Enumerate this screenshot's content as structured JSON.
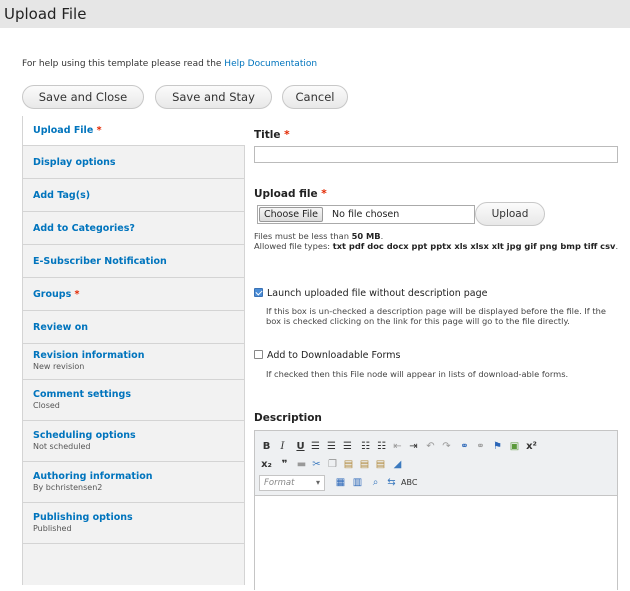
{
  "header": {
    "title": "Upload File"
  },
  "help": {
    "prefix": "For help using this template please read the ",
    "link": "Help Documentation"
  },
  "actions": {
    "save_close": "Save and Close",
    "save_stay": "Save and Stay",
    "cancel": "Cancel"
  },
  "tabs": [
    {
      "title": "Upload File",
      "required": true,
      "summary": ""
    },
    {
      "title": "Display options",
      "required": false,
      "summary": ""
    },
    {
      "title": "Add Tag(s)",
      "required": false,
      "summary": ""
    },
    {
      "title": "Add to Categories?",
      "required": false,
      "summary": ""
    },
    {
      "title": "E-Subscriber Notification",
      "required": false,
      "summary": ""
    },
    {
      "title": "Groups",
      "required": true,
      "summary": ""
    },
    {
      "title": "Review on",
      "required": false,
      "summary": ""
    },
    {
      "title": "Revision information",
      "required": false,
      "summary": "New revision"
    },
    {
      "title": "Comment settings",
      "required": false,
      "summary": "Closed"
    },
    {
      "title": "Scheduling options",
      "required": false,
      "summary": "Not scheduled"
    },
    {
      "title": "Authoring information",
      "required": false,
      "summary": "By bchristensen2"
    },
    {
      "title": "Publishing options",
      "required": false,
      "summary": "Published"
    }
  ],
  "form": {
    "title_label": "Title",
    "title_value": "",
    "upload_label": "Upload file",
    "choose_file": "Choose File",
    "no_file": "No file chosen",
    "upload_button": "Upload",
    "size_prefix": "Files must be less than ",
    "size_value": "50 MB",
    "size_suffix": ".",
    "types_prefix": "Allowed file types: ",
    "types_value": "txt pdf doc docx ppt pptx xls xlsx xlt jpg gif png bmp tiff csv",
    "types_suffix": ".",
    "launch_label": "Launch uploaded file without description page",
    "launch_checked": true,
    "launch_desc": "If this box is un-checked a description page will be displayed before the file. If the box is checked clicking on the link for this page will go to the file directly.",
    "downloadable_label": "Add to Downloadable Forms",
    "downloadable_checked": false,
    "downloadable_desc": "If checked then this File node will appear in lists of download-able forms.",
    "description_label": "Description",
    "format_placeholder": "Format"
  },
  "colors": {
    "link": "#0074bd",
    "required": "#e32700",
    "header_bg": "#e6e6e6",
    "tab_bg": "#f2f2f2"
  }
}
